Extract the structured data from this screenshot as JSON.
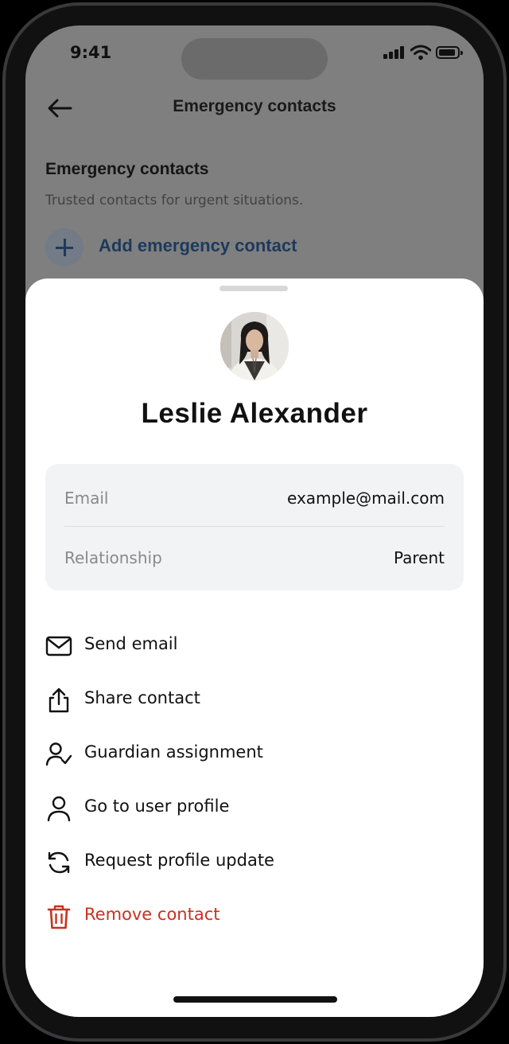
{
  "status_bar": {
    "time": "9:41"
  },
  "header": {
    "title": "Emergency contacts",
    "back_icon": "arrow-left-icon"
  },
  "section": {
    "title": "Emergency contacts",
    "subtitle": "Trusted contacts for urgent situations.",
    "add_label": "Add emergency contact"
  },
  "sheet": {
    "contact_name": "Leslie Alexander",
    "details": [
      {
        "label": "Email",
        "value": "example@mail.com"
      },
      {
        "label": "Relationship",
        "value": "Parent"
      }
    ],
    "actions": [
      {
        "label": "Send email",
        "icon": "mail-icon"
      },
      {
        "label": "Share contact",
        "icon": "share-icon"
      },
      {
        "label": "Guardian assignment",
        "icon": "user-check-icon"
      },
      {
        "label": "Go to user profile",
        "icon": "user-icon"
      },
      {
        "label": "Request profile update",
        "icon": "refresh-icon"
      },
      {
        "label": "Remove contact",
        "icon": "trash-icon"
      }
    ]
  },
  "colors": {
    "danger": "#c8321e",
    "accent": "#1c3a5c",
    "overlay": "#7f7f7f"
  }
}
